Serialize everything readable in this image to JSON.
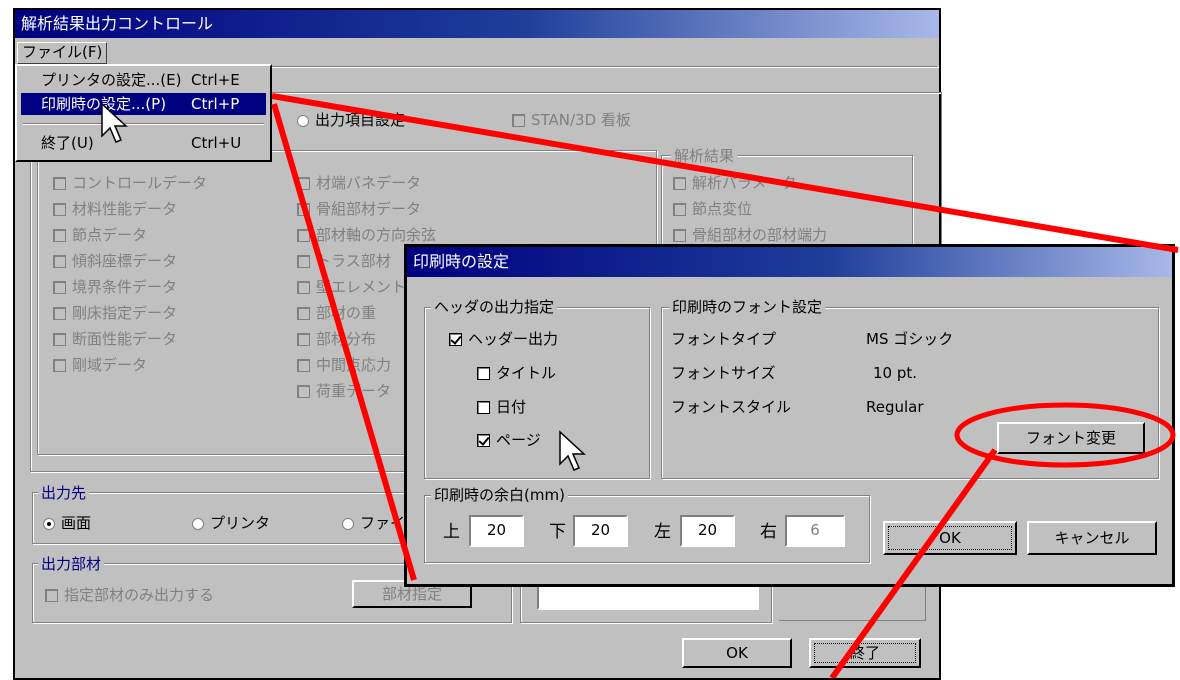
{
  "main_window": {
    "title": "解析結果出力コントロール",
    "menubar": {
      "file": "ファイル(F)"
    },
    "file_menu": [
      {
        "label": "プリンタの設定...(E)",
        "shortcut": "Ctrl+E"
      },
      {
        "label": "印刷時の設定...(P)",
        "shortcut": "Ctrl+P"
      },
      {
        "label": "終了(U)",
        "shortcut": "Ctrl+U"
      }
    ],
    "top_options": {
      "output_item_radio": "出力項目設定",
      "stan3d_checkbox": "STAN/3D 看板"
    },
    "input_data_col1": [
      "コントロールデータ",
      "材料性能データ",
      "節点データ",
      "傾斜座標データ",
      "境界条件データ",
      "剛床指定データ",
      "断面性能データ",
      "剛域データ"
    ],
    "input_data_col2": [
      "材端バネデータ",
      "骨組部材データ",
      "部材軸の方向余弦",
      "トラス部材",
      "壁エレメント",
      "部材の重",
      "部材分布",
      "中間点応力",
      "荷重データ"
    ],
    "analysis_results": {
      "legend": "解析結果",
      "items": [
        "解析パラメータ",
        "節点変位",
        "骨組部材の部材端力"
      ]
    },
    "output_dest": {
      "legend": "出力先",
      "options": [
        "画面",
        "プリンタ",
        "ファイル"
      ],
      "selected": "画面"
    },
    "output_member": {
      "legend": "出力部材",
      "checkbox": "指定部材のみ出力する",
      "button": "部材指定"
    },
    "ok_button": "OK",
    "exit_button": "終了"
  },
  "print_dialog": {
    "title": "印刷時の設定",
    "header_group": {
      "legend": "ヘッダの出力指定",
      "header_output": {
        "label": "ヘッダー出力",
        "checked": true
      },
      "title": {
        "label": "タイトル",
        "checked": false
      },
      "date": {
        "label": "日付",
        "checked": false
      },
      "page": {
        "label": "ページ",
        "checked": true
      }
    },
    "font_group": {
      "legend": "印刷時のフォント設定",
      "rows": [
        {
          "label": "フォントタイプ",
          "value": "MS ゴシック"
        },
        {
          "label": "フォントサイズ",
          "value": "10 pt."
        },
        {
          "label": "フォントスタイル",
          "value": "Regular"
        }
      ],
      "change_button": "フォント変更"
    },
    "margin_group": {
      "legend": "印刷時の余白(mm)",
      "fields": [
        {
          "label": "上",
          "value": "20"
        },
        {
          "label": "下",
          "value": "20"
        },
        {
          "label": "左",
          "value": "20"
        },
        {
          "label": "右",
          "value": "6"
        }
      ]
    },
    "ok_button": "OK",
    "cancel_button": "キャンセル"
  },
  "annotation_color": "#ff0000"
}
